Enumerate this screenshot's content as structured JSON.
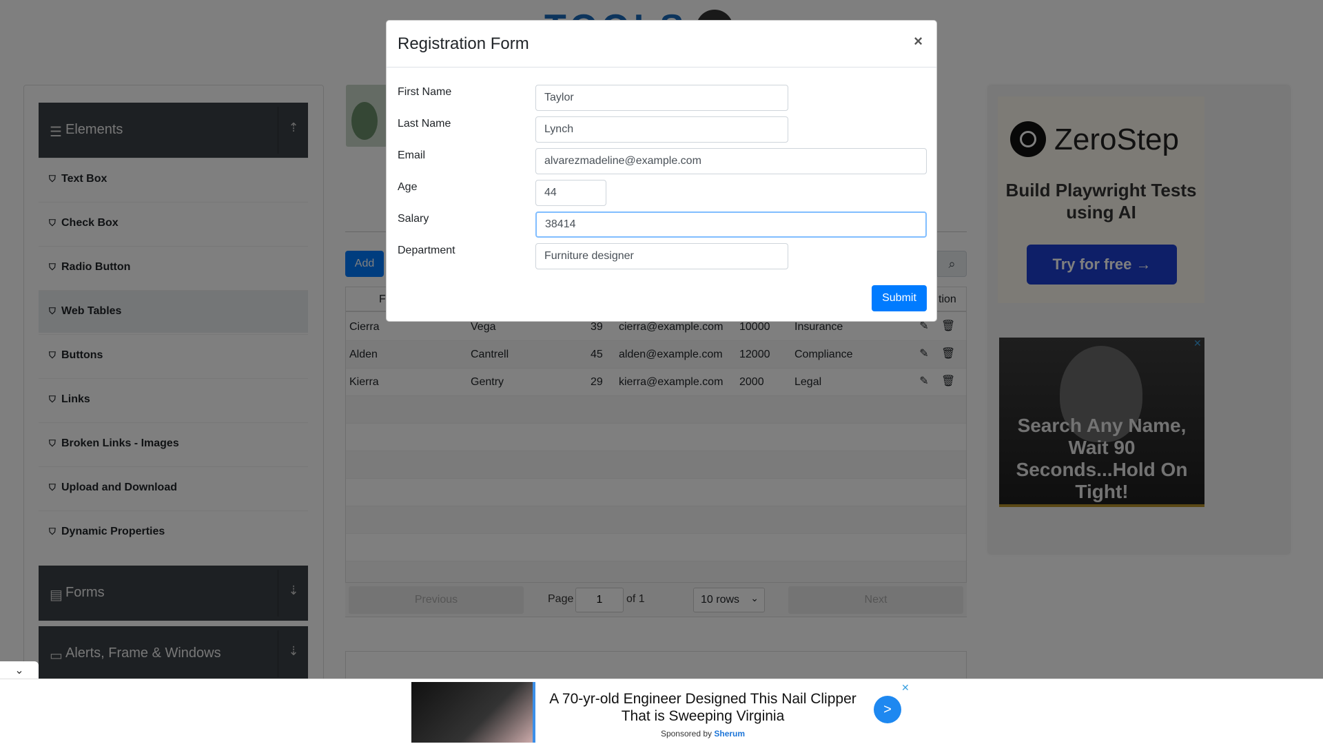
{
  "logo": {
    "text": "TOOLS"
  },
  "sidebar": {
    "groups": [
      {
        "title": "Elements",
        "icon": "hamburger-icon",
        "arrow": "⇡"
      },
      {
        "title": "Forms",
        "icon": "form-icon",
        "arrow": "⇣"
      },
      {
        "title": "Alerts, Frame & Windows",
        "icon": "window-icon",
        "arrow": "⇣"
      }
    ],
    "items": [
      {
        "label": "Text Box"
      },
      {
        "label": "Check Box"
      },
      {
        "label": "Radio Button"
      },
      {
        "label": "Web Tables"
      },
      {
        "label": "Buttons"
      },
      {
        "label": "Links"
      },
      {
        "label": "Broken Links - Images"
      },
      {
        "label": "Upload and Download"
      },
      {
        "label": "Dynamic Properties"
      }
    ]
  },
  "webtable": {
    "add_label": "Add",
    "headers": {
      "first": "Fi",
      "action": "tion"
    },
    "rows": [
      {
        "first": "Cierra",
        "last": "Vega",
        "age": "39",
        "email": "cierra@example.com",
        "salary": "10000",
        "dept": "Insurance"
      },
      {
        "first": "Alden",
        "last": "Cantrell",
        "age": "45",
        "email": "alden@example.com",
        "salary": "12000",
        "dept": "Compliance"
      },
      {
        "first": "Kierra",
        "last": "Gentry",
        "age": "29",
        "email": "kierra@example.com",
        "salary": "2000",
        "dept": "Legal"
      }
    ],
    "pager": {
      "previous": "Previous",
      "page_label": "Page",
      "page_value": "1",
      "of_label": "of 1",
      "rows_select": "10 rows",
      "next": "Next"
    }
  },
  "modal": {
    "title": "Registration Form",
    "close": "×",
    "fields": {
      "first_name": {
        "label": "First Name",
        "value": "Taylor"
      },
      "last_name": {
        "label": "Last Name",
        "value": "Lynch"
      },
      "email": {
        "label": "Email",
        "value": "alvarezmadeline@example.com"
      },
      "age": {
        "label": "Age",
        "value": "44"
      },
      "salary": {
        "label": "Salary",
        "value": "38414"
      },
      "department": {
        "label": "Department",
        "value": "Furniture designer"
      }
    },
    "submit": "Submit"
  },
  "right_ad": {
    "brand": "ZeroStep",
    "tagline": "Build Playwright Tests using AI",
    "cta": "Try for free →",
    "face_text": "Search Any Name, Wait 90 Seconds...Hold On Tight!",
    "close": "✕"
  },
  "bottom_ad": {
    "title": "A 70-yr-old Engineer Designed This Nail Clipper That is Sweeping Virginia",
    "sponsored_prefix": "Sponsored by",
    "sponsor": "Sherum",
    "close": "✕",
    "arrow": ">"
  },
  "collapse_tab": {
    "icon": "chevron-down-icon",
    "glyph": "⌄"
  },
  "colors": {
    "primary": "#007bff",
    "sidebar_dark": "#3b4047",
    "zerostep_button": "#1d3fd0",
    "overlay": "rgba(0,0,0,0.5)"
  }
}
